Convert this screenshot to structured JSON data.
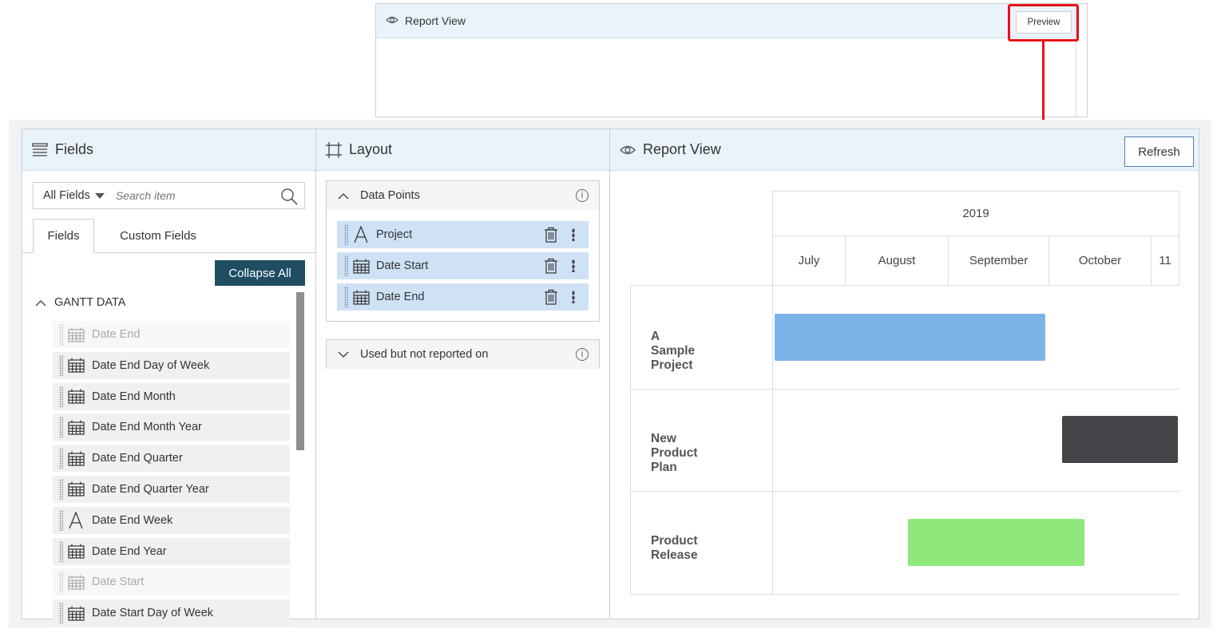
{
  "mini_view": {
    "title": "Report View",
    "preview_label": "Preview"
  },
  "fields": {
    "title": "Fields",
    "filter_label": "All Fields",
    "search_placeholder": "Search item",
    "tabs": [
      "Fields",
      "Custom Fields"
    ],
    "collapse_label": "Collapse All",
    "group_label": "GANTT DATA",
    "items": [
      {
        "label": "Date End",
        "icon": "calendar-icon",
        "dim": true
      },
      {
        "label": "Date End Day of Week",
        "icon": "calendar-icon",
        "dim": false
      },
      {
        "label": "Date End Month",
        "icon": "calendar-icon",
        "dim": false
      },
      {
        "label": "Date End Month Year",
        "icon": "calendar-icon",
        "dim": false
      },
      {
        "label": "Date End Quarter",
        "icon": "calendar-icon",
        "dim": false
      },
      {
        "label": "Date End Quarter Year",
        "icon": "calendar-icon",
        "dim": false
      },
      {
        "label": "Date End Week",
        "icon": "text-icon",
        "dim": false
      },
      {
        "label": "Date End Year",
        "icon": "calendar-icon",
        "dim": false
      },
      {
        "label": "Date Start",
        "icon": "calendar-icon",
        "dim": true
      },
      {
        "label": "Date Start Day of Week",
        "icon": "calendar-icon",
        "dim": false
      }
    ]
  },
  "layout": {
    "title": "Layout",
    "data_points_label": "Data Points",
    "data_points": [
      {
        "label": "Project",
        "icon": "text-icon"
      },
      {
        "label": "Date Start",
        "icon": "calendar-icon"
      },
      {
        "label": "Date End",
        "icon": "calendar-icon"
      }
    ],
    "unused_label": "Used but not reported on",
    "info_glyph": "i"
  },
  "report": {
    "title": "Report View",
    "refresh_label": "Refresh",
    "year": "2019",
    "months": [
      "July",
      "August",
      "September",
      "October",
      "11"
    ],
    "rows": [
      {
        "label": "A Sample Project",
        "color": "#7cb4ea",
        "start": "2019-07-01",
        "end": "2019-09-30"
      },
      {
        "label": "New Product Plan",
        "color": "#444449",
        "start": "2019-10-05",
        "end": "2019-11-20"
      },
      {
        "label": "Product Release",
        "color": "#8ee87c",
        "start": "2019-08-20",
        "end": "2019-10-12"
      }
    ]
  },
  "colors": {
    "accent": "#1f4e63",
    "highlight": "#e8121a",
    "header_bg": "#eaf3fa",
    "selected_item": "#cfe1f5"
  }
}
